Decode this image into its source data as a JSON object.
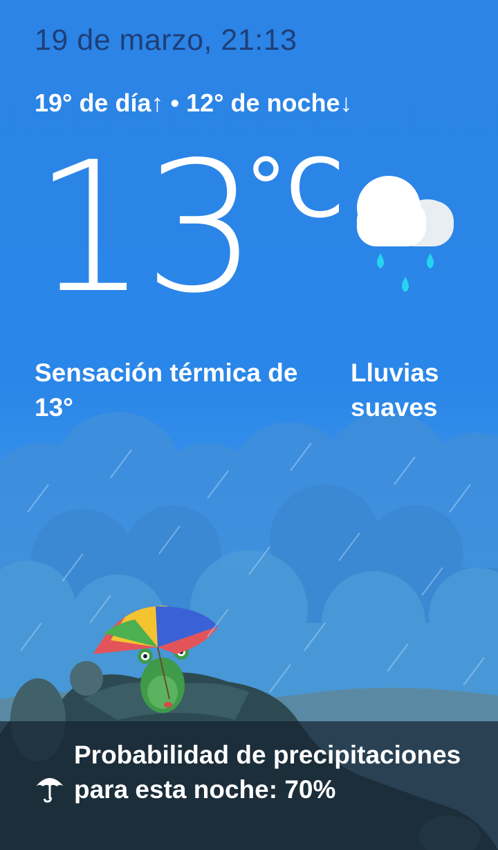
{
  "header": {
    "datetime": "19 de marzo, 21:13",
    "high_low": "19° de día↑ • 12° de noche↓"
  },
  "current": {
    "temperature": "13",
    "unit": "°C",
    "feels_like": "Sensación térmica de 13°",
    "condition": "Lluvias suaves",
    "condition_icon": "rain-cloud-icon"
  },
  "footer": {
    "precipitation_text": "Probabilidad de precipitaciones para esta noche: 70%",
    "precipitation_icon": "umbrella-icon"
  },
  "colors": {
    "sky": "#2a86e8",
    "date_text": "#1f3f78",
    "rain_drop": "#26d4ef",
    "frog": "#3f9a4a"
  }
}
